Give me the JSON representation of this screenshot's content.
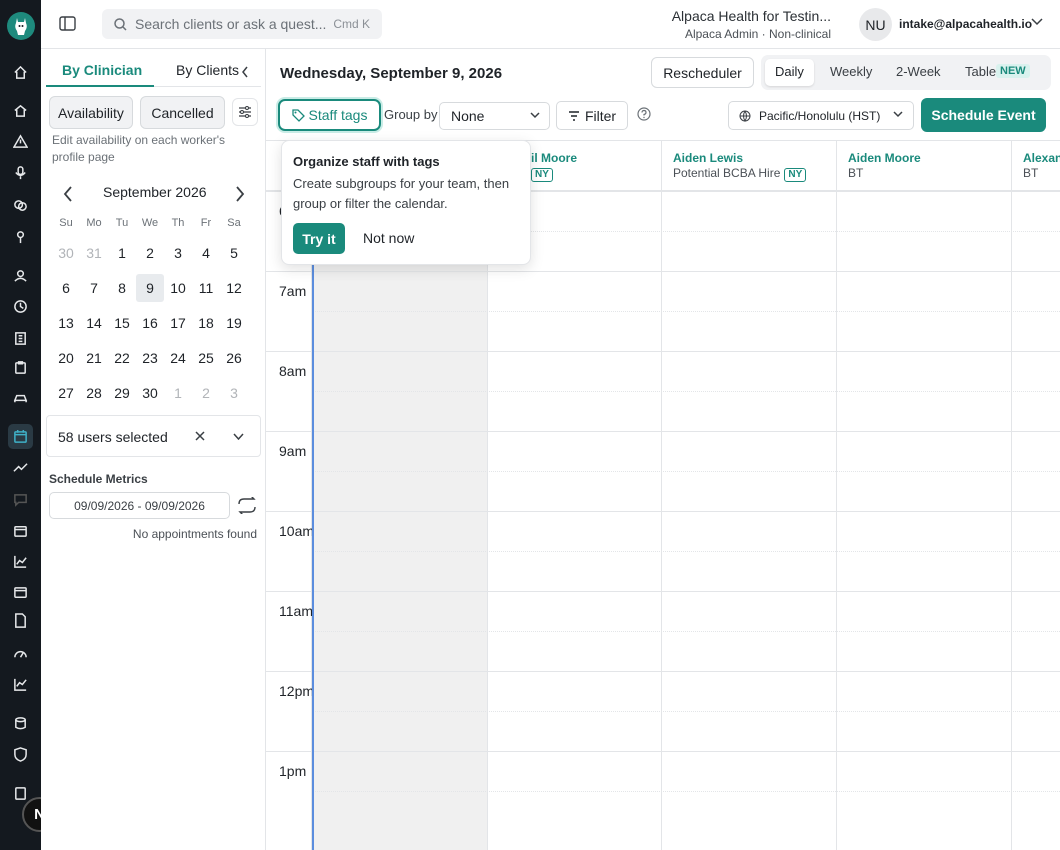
{
  "rail": {
    "avatar_initial": "N"
  },
  "topbar": {
    "search_placeholder": "Search clients or ask a quest...",
    "search_shortcut": "Cmd K",
    "org_name": "Alpaca Health for Testin...",
    "org_role": "Alpaca Admin · Non-clinical",
    "user_initials": "NU",
    "user_email": "intake@alpacahealth.io"
  },
  "left": {
    "tab_clinician": "By Clinician",
    "tab_clients": "By Clients",
    "btn_availability": "Availability",
    "btn_cancelled": "Cancelled",
    "hint": "Edit availability on each worker's profile page",
    "month": "September 2026",
    "dow": [
      "Su",
      "Mo",
      "Tu",
      "We",
      "Th",
      "Fr",
      "Sa"
    ],
    "weeks": [
      [
        "30",
        "31",
        "1",
        "2",
        "3",
        "4",
        "5"
      ],
      [
        "6",
        "7",
        "8",
        "9",
        "10",
        "11",
        "12"
      ],
      [
        "13",
        "14",
        "15",
        "16",
        "17",
        "18",
        "19"
      ],
      [
        "20",
        "21",
        "22",
        "23",
        "24",
        "25",
        "26"
      ],
      [
        "27",
        "28",
        "29",
        "30",
        "1",
        "2",
        "3"
      ]
    ],
    "selected_day": "9",
    "users_selected": "58 users selected",
    "metrics_title": "Schedule Metrics",
    "date_range": "09/09/2026 - 09/09/2026",
    "no_appointments": "No appointments found"
  },
  "main": {
    "date_title": "Wednesday, September 9, 2026",
    "rescheduler": "Rescheduler",
    "views": [
      "Daily",
      "Weekly",
      "2-Week",
      "Table"
    ],
    "active_view": "Daily",
    "new_badge": "NEW",
    "staff_tags": "Staff tags",
    "group_by_label": "Group by",
    "group_by_value": "None",
    "filter": "Filter",
    "timezone": "Pacific/Honolulu (HST)",
    "schedule_event": "Schedule Event"
  },
  "columns": [
    {
      "name": "il Moore",
      "role": "",
      "badge": "NY"
    },
    {
      "name": "Aiden Lewis",
      "role": "Potential BCBA Hire",
      "badge": "NY"
    },
    {
      "name": "Aiden Moore",
      "role": "BT",
      "badge": ""
    },
    {
      "name": "Alexan",
      "role": "BT",
      "badge": ""
    }
  ],
  "times": [
    "6am",
    "7am",
    "8am",
    "9am",
    "10am",
    "11am",
    "12pm",
    "1pm"
  ],
  "popover": {
    "title": "Organize staff with tags",
    "body": "Create subgroups for your team, then group or filter the calendar.",
    "try_it": "Try it",
    "not_now": "Not now"
  },
  "colors": {
    "accent": "#1a8a7c",
    "rail": "#14191f",
    "now_line": "#5b8dde"
  }
}
